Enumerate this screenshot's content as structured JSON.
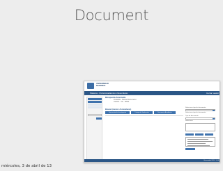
{
  "slide": {
    "title": "Document",
    "date": "miércoles, 3 de abril de 13"
  },
  "screenshot": {
    "logo_text": [
      "UNIVERSIDAD",
      "NACIONAL"
    ],
    "app_title": "Sistema · Portal Académico Universitario",
    "logout": "Cerrar sesión",
    "breadcrumb_title": "Búsqueda Avanzada",
    "breadcrumb_lines": [
      "Portafolio · Buscar Documento",
      "Gestión · Ver · Editar"
    ],
    "results_title": "Buscar (menor a 8 caracteres)",
    "tabs": [
      "Documento de Investigación",
      "Trabajo de Graduación",
      "Documento Académico"
    ],
    "filters": [
      "Seleccione tipo de documento",
      "Seleccione tipo de documento",
      "Tipo de documento",
      "Seleccione"
    ],
    "footer": "Universidad 2013 · 1.0.0"
  },
  "colors": {
    "accent": "#2b5686",
    "button": "#3e72ad",
    "background": "#ededed"
  }
}
